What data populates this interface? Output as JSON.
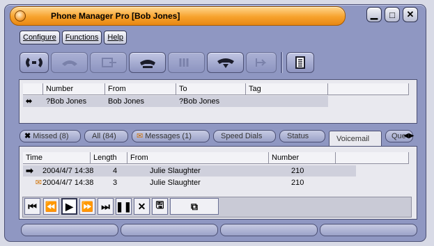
{
  "window": {
    "title": "Phone Manager Pro  [Bob Jones]"
  },
  "menu": {
    "configure": "Configure",
    "functions": "Functions",
    "help": "Help"
  },
  "calls": {
    "columns": [
      "",
      "Number",
      "From",
      "To",
      "Tag"
    ],
    "rows": [
      {
        "number": "?Bob Jones",
        "from": "Bob Jones",
        "to": "?Bob Jones",
        "tag": ""
      }
    ]
  },
  "tabs": [
    {
      "label": "Missed (8)",
      "icon": "x-icon"
    },
    {
      "label": "All (84)"
    },
    {
      "label": "Messages (1)",
      "icon": "envelope-icon"
    },
    {
      "label": "Speed Dials"
    },
    {
      "label": "Status"
    },
    {
      "label": "Voicemail",
      "active": true
    },
    {
      "label": "Que"
    }
  ],
  "voicemail": {
    "columns": [
      "Time",
      "Length",
      "From",
      "Number"
    ],
    "rows": [
      {
        "time": "2004/4/7 14:38",
        "length": "4",
        "from": "Julie Slaughter",
        "number": "210",
        "marker": "arrow-right-icon"
      },
      {
        "time": "2004/4/7 14:38",
        "length": "3",
        "from": "Julie Slaughter",
        "number": "210",
        "marker": "envelope-icon"
      }
    ]
  },
  "colors": {
    "frame": "#8f97c2",
    "title": "#f7a22c",
    "panel": "#e9e9ef"
  }
}
